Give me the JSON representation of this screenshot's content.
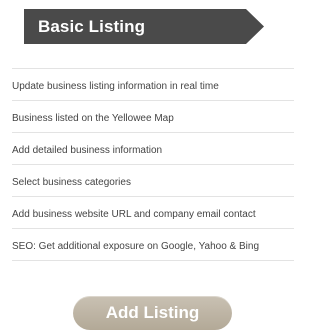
{
  "banner": {
    "title": "Basic Listing",
    "color": "#4a4a4a"
  },
  "features": [
    "Update business listing information in real time",
    "Business listed on the Yellowee Map",
    "Add detailed business information",
    "Select business categories",
    "Add business website URL and company email contact",
    "SEO: Get additional exposure on Google, Yahoo & Bing"
  ],
  "cta": {
    "label": "Add Listing",
    "color": "#bdb4a3"
  }
}
